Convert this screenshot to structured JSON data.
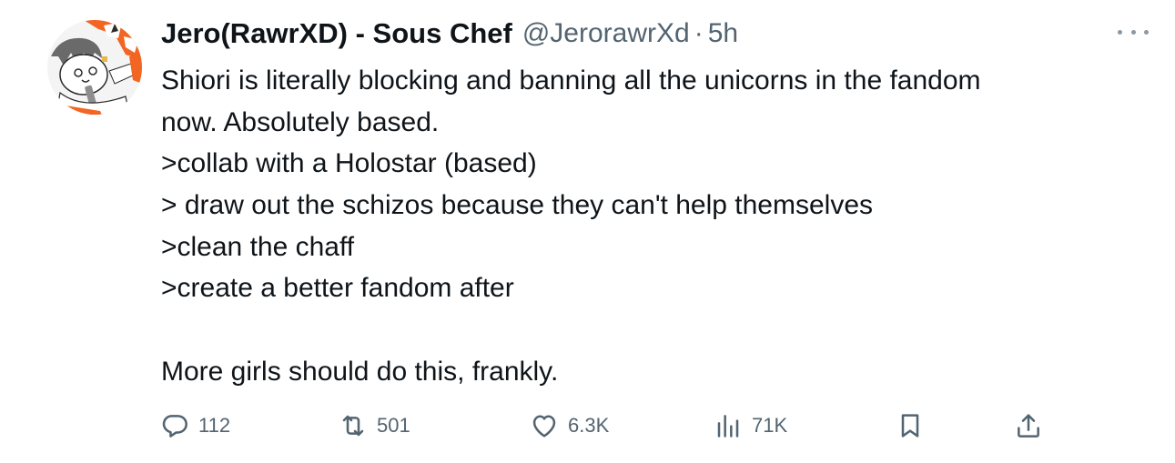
{
  "tweet": {
    "author_name": "Jero(RawrXD) - Sous Chef",
    "handle": "@JerorawrXd",
    "separator": "·",
    "time": "5h",
    "lines": [
      "Shiori is literally blocking and banning all the unicorns in the fandom",
      "now. Absolutely based.",
      ">collab with a Holostar (based)",
      "> draw out the schizos because they can't help themselves",
      ">clean the chaff",
      ">create a better fandom after",
      "",
      "More girls should do this, frankly."
    ]
  },
  "actions": {
    "reply": {
      "icon": "reply-icon",
      "count": "112"
    },
    "retweet": {
      "icon": "retweet-icon",
      "count": "501"
    },
    "like": {
      "icon": "heart-icon",
      "count": "6.3K"
    },
    "views": {
      "icon": "views-icon",
      "count": "71K"
    },
    "bookmark": {
      "icon": "bookmark-icon"
    },
    "share": {
      "icon": "share-icon"
    }
  },
  "colors": {
    "text": "#0f1419",
    "secondary": "#536471",
    "more_dots": "#8b98a5",
    "avatar_orange": "#f26522"
  }
}
